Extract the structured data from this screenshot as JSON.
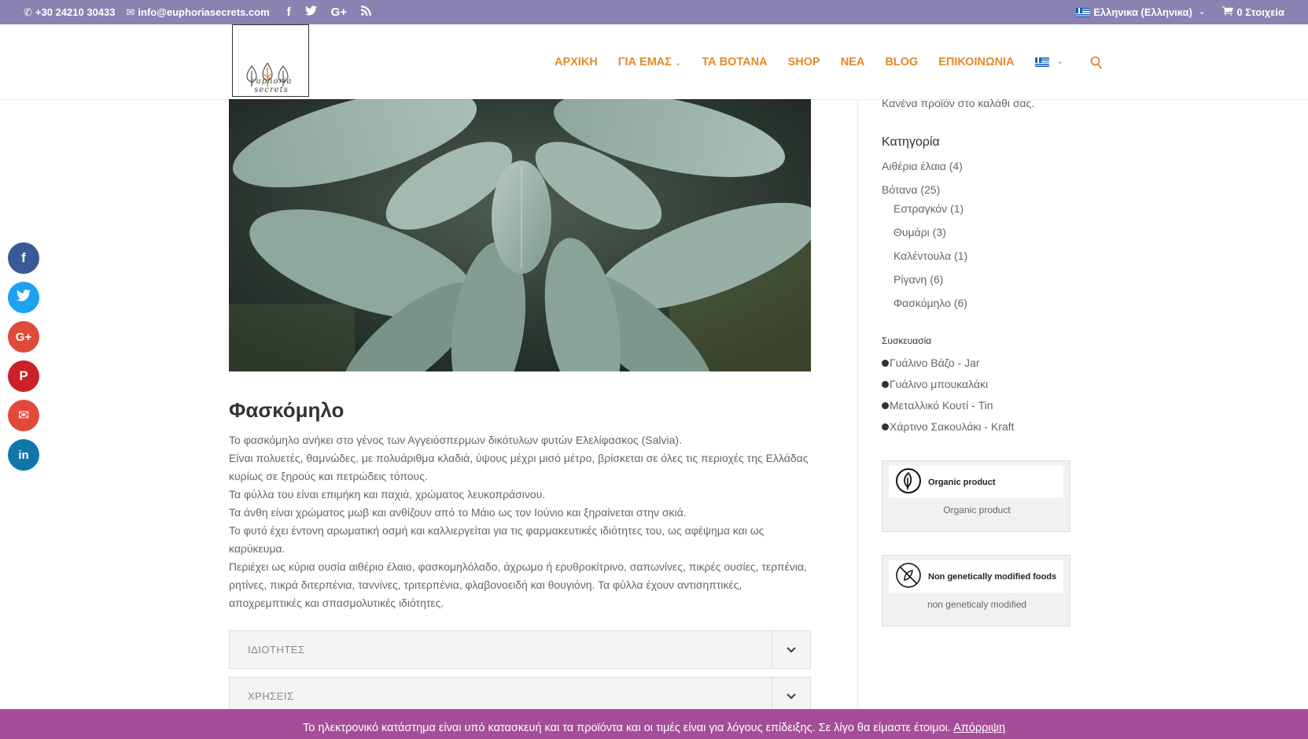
{
  "topbar": {
    "phone": "+30 24210 30433",
    "email": "info@euphoriasecrets.com",
    "social_icons": [
      "facebook-icon",
      "twitter-icon",
      "google-plus-icon",
      "rss-icon"
    ],
    "language": "Ελληνικα (Ελληνικα)",
    "cart": "0 Στοιχεία"
  },
  "logo": {
    "brand": "euphoria secrets"
  },
  "nav": {
    "items": [
      {
        "label": "ΑΡΧΙΚΗ",
        "dropdown": false
      },
      {
        "label": "ΓΙΑ ΕΜΑΣ",
        "dropdown": true
      },
      {
        "label": "ΤΑ ΒΟΤΑΝΑ",
        "dropdown": false
      },
      {
        "label": "SHOP",
        "dropdown": false
      },
      {
        "label": "ΝΕΑ",
        "dropdown": false
      },
      {
        "label": "BLOG",
        "dropdown": false
      },
      {
        "label": "ΕΠΙΚΟΙΝΩΝΙΑ",
        "dropdown": false
      }
    ]
  },
  "main": {
    "title": "Φασκόμηλο",
    "paragraphs": [
      "Το φασκόμηλο ανήκει στο γένος των Αγγειόσπερμων δικότυλων φυτών Ελελίφασκος (Salvia).",
      "Είναι πολυετές, θαμνώδες, με πολυάριθμα κλαδιά, ύψους μέχρι μισό μέτρο, βρίσκεται σε όλες τις περιοχές της Ελλάδας κυρίως σε ξηρούς και πετρώδεις τόπους.",
      "Τα φύλλα του είναι επιμήκη και παχιά, χρώματος λευκοπράσινου.",
      "Τα άνθη είναι χρώματος μωβ και ανθίζουν από το Μάιο ως τον Ιούνιο και ξηραίνεται στην σκιά.",
      "Το φυτό έχει έντονη αρωματική οσμή και καλλιεργείται για τις φαρμακευτικές ιδιότητες του, ως αφέψημα και ως καρύκευμα.",
      "Περιέχει ως κύρια ουσία αιθέριο έλαιο, φασκομηλόλαδο, άχρωμο ή ερυθροκίτρινο, σαπωνίνες, πικρές ουσίες, τερπένια, ρητίνες, πικρά διτερπένια, ταννίνες, τριτερπένια, φλαβονοειδή και θουγιόνη. Τα φύλλα έχουν αντισηπτικές, αποχρεμπτικές και σπασμολυτικές ιδιότητες."
    ],
    "accordions": [
      "ΙΔΙΟΤΗΤΕΣ",
      "ΧΡΗΣΕΙΣ"
    ]
  },
  "sidebar": {
    "cart_empty": "Κανένα προϊόν στο καλάθι σας.",
    "category_title": "Κατηγορία",
    "categories": [
      {
        "label": "Αιθέρια έλαια",
        "count": "(4)"
      },
      {
        "label": "Βότανα",
        "count": "(25)"
      }
    ],
    "subcategories": [
      {
        "label": "Εστραγκόν",
        "count": "(1)"
      },
      {
        "label": "Θυμάρι",
        "count": "(3)"
      },
      {
        "label": "Καλέντουλα",
        "count": "(1)"
      },
      {
        "label": "Ρίγανη",
        "count": "(6)"
      },
      {
        "label": "Φασκόμηλο",
        "count": "(6)"
      }
    ],
    "packaging_title": "Συσκευασία",
    "packaging": [
      "Γυάλινο Βάζο - Jar",
      "Γυάλινο μπουκαλάκι",
      "Μεταλλικό Κουτί - Tin",
      "Χάρτινο Σακουλάκι - Kraft"
    ],
    "badges": [
      {
        "title": "Organic product",
        "caption": "Organic product",
        "icon": "leaf-icon"
      },
      {
        "title": "Non genetically modified foods",
        "caption": "non geneticaly modified",
        "icon": "no-gmo-icon"
      }
    ]
  },
  "share_buttons": [
    {
      "name": "facebook",
      "glyph": "f",
      "color": "#3b5998"
    },
    {
      "name": "twitter",
      "glyph": "t",
      "color": "#1da1f2"
    },
    {
      "name": "google-plus",
      "glyph": "G+",
      "color": "#dd4b39"
    },
    {
      "name": "pinterest",
      "glyph": "P",
      "color": "#cb2027"
    },
    {
      "name": "email",
      "glyph": "✉",
      "color": "#e04a3c"
    },
    {
      "name": "linkedin",
      "glyph": "in",
      "color": "#0e76a8"
    }
  ],
  "cookie": {
    "text": "Το ηλεκτρονικό κατάστημα είναι υπό κατασκευή και τα προϊόντα και οι τιμές είναι για λόγους επίδειξης. Σε λίγο θα είμαστε έτοιμοι.",
    "dismiss": "Απόρριψη"
  }
}
